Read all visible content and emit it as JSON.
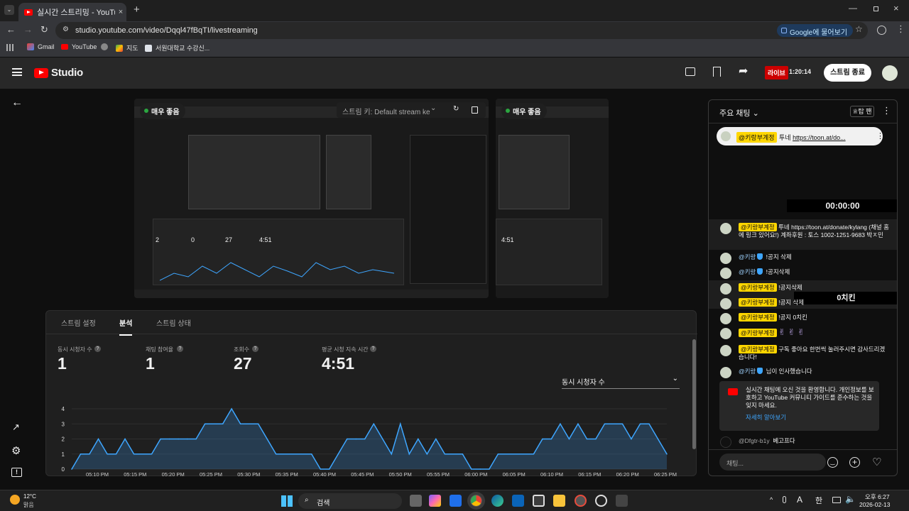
{
  "browser": {
    "tab_title": "실시간 스트리밍 - YouTube Stu",
    "url": "studio.youtube.com/video/Dqql47fBqTI/livestreaming",
    "google_button": "Google에 물어보기",
    "bookmarks": [
      "Gmail",
      "YouTube",
      "지도",
      "서원대학교 수강신..."
    ]
  },
  "header": {
    "logo": "Studio",
    "live_label": "라이브",
    "live_time": "1:20:14",
    "end_stream": "스트림 종료"
  },
  "preview": {
    "quality_main": "매우 좋음",
    "stream_key": "스트림 키: Default stream ke",
    "quality_side": "매우 좋음",
    "side_value": "4:51"
  },
  "analytics": {
    "tabs": [
      "스트림 설정",
      "분석",
      "스트림 상태"
    ],
    "active_tab": "분석",
    "stats": [
      {
        "label": "동시 시청자 수",
        "value": "1"
      },
      {
        "label": "채팅 참여율",
        "value": "1"
      },
      {
        "label": "조회수",
        "value": "27"
      },
      {
        "label": "평균 시청 지속 시간",
        "value": "4:51"
      }
    ],
    "dropdown": "동시 시청자 수",
    "chart_data": {
      "type": "area",
      "ylim": [
        0,
        4
      ],
      "y_ticks": [
        "0",
        "1",
        "2",
        "3",
        "4"
      ],
      "x_ticks": [
        "05:10 PM",
        "05:15 PM",
        "05:20 PM",
        "05:25 PM",
        "05:30 PM",
        "05:35 PM",
        "05:40 PM",
        "05:45 PM",
        "05:50 PM",
        "05:55 PM",
        "06:00 PM",
        "06:05 PM",
        "06:10 PM",
        "06:15 PM",
        "06:20 PM",
        "06:25 PM"
      ],
      "values": [
        0,
        1,
        1,
        2,
        1,
        1,
        2,
        1,
        1,
        1,
        2,
        2,
        2,
        2,
        2,
        3,
        3,
        3,
        4,
        3,
        3,
        3,
        2,
        1,
        1,
        1,
        1,
        1,
        0,
        0,
        1,
        2,
        2,
        2,
        3,
        2,
        1,
        3,
        1,
        2,
        1,
        2,
        1,
        1,
        1,
        0,
        0,
        0,
        1,
        1,
        1,
        1,
        1,
        2,
        2,
        3,
        2,
        3,
        2,
        2,
        3,
        3,
        3,
        2,
        3,
        3,
        2,
        1
      ]
    }
  },
  "chat": {
    "title": "주요 채팅",
    "pinned_user": "@키랑부계정",
    "pinned_text": "투네 ",
    "pinned_link": "https://toon.at/do...",
    "timer": "00:00:00",
    "overlay_text": "0치킨",
    "messages": [
      {
        "user": "@키랑부계정",
        "highlight": true,
        "text": "투네 https://toon.at/donate/kylang (채널 홈에 링크 있어요!) 계좌후원 : 토스 1002-1251-9683 박ㅈ민"
      },
      {
        "user": "@키랑",
        "highlight": false,
        "text": "!공지 삭제"
      },
      {
        "user": "@키랑",
        "highlight": false,
        "text": "!공지삭제"
      },
      {
        "user": "@키랑부계정",
        "highlight": true,
        "text": "!공지삭제"
      },
      {
        "user": "@키랑부계정",
        "highlight": true,
        "text": "!공지 삭제"
      },
      {
        "user": "@키랑부계정",
        "highlight": true,
        "text": "!공지 0치킨"
      },
      {
        "user": "@키랑부계정",
        "highlight": true,
        "text": "✌ ✌ ✌"
      },
      {
        "user": "@키랑부계정",
        "highlight": true,
        "text": "구독 좋아요 한번씩 눌러주시면 감사드리겠습니다!"
      },
      {
        "user": "@키랑",
        "highlight": false,
        "text": "님이 인사했습니다"
      }
    ],
    "notice_text": "실시간 채팅에 오신 것을 환영합니다. 개인정보를 보호하고 YouTube 커뮤니티 가이드를 준수하는 것을 잊지 마세요.",
    "notice_link": "자세히 알아보기",
    "last_user": "@Dfgtr-b1y",
    "last_text": "베고프다",
    "input_placeholder": "채팅..."
  },
  "taskbar": {
    "weather_temp": "12°C",
    "weather_desc": "맑음",
    "search": "검색",
    "ime": "A",
    "lang": "한",
    "time": "오후 6:27",
    "date": "2026-02-13"
  },
  "colors": {
    "accent_live": "#cc0000",
    "highlight": "#ffd600",
    "chart_line": "#3ea6ff"
  }
}
